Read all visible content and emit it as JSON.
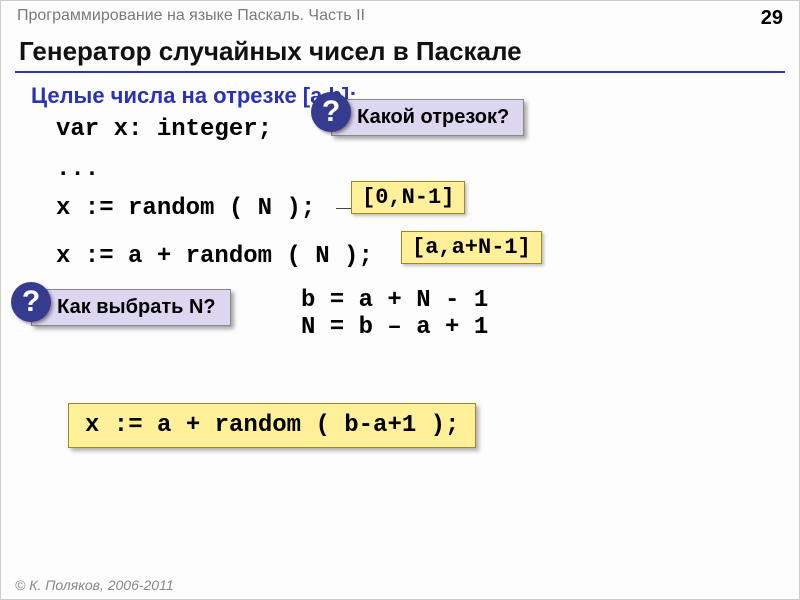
{
  "header": {
    "breadcrumb": "Программирование на языке Паскаль. Часть II",
    "page": "29"
  },
  "title": "Генератор случайных чисел в Паскале",
  "subtitle": "Целые числа на отрезке [a,b]:",
  "code": {
    "line1": "var x: integer;",
    "line2": "...",
    "line3": "x := random ( N );",
    "line4": "x := a + random ( N );"
  },
  "callouts": {
    "q1": {
      "mark": "?",
      "text": "Какой отрезок?"
    },
    "q2": {
      "mark": "?",
      "text": "Как выбрать N?"
    }
  },
  "highlights": {
    "h1": "[0,N-1]",
    "h2": "[a,a+N-1]",
    "final": "x := a + random ( b-a+1 );"
  },
  "equations": "b = a + N - 1\nN = b – a + 1",
  "footer": "© К. Поляков, 2006-2011"
}
